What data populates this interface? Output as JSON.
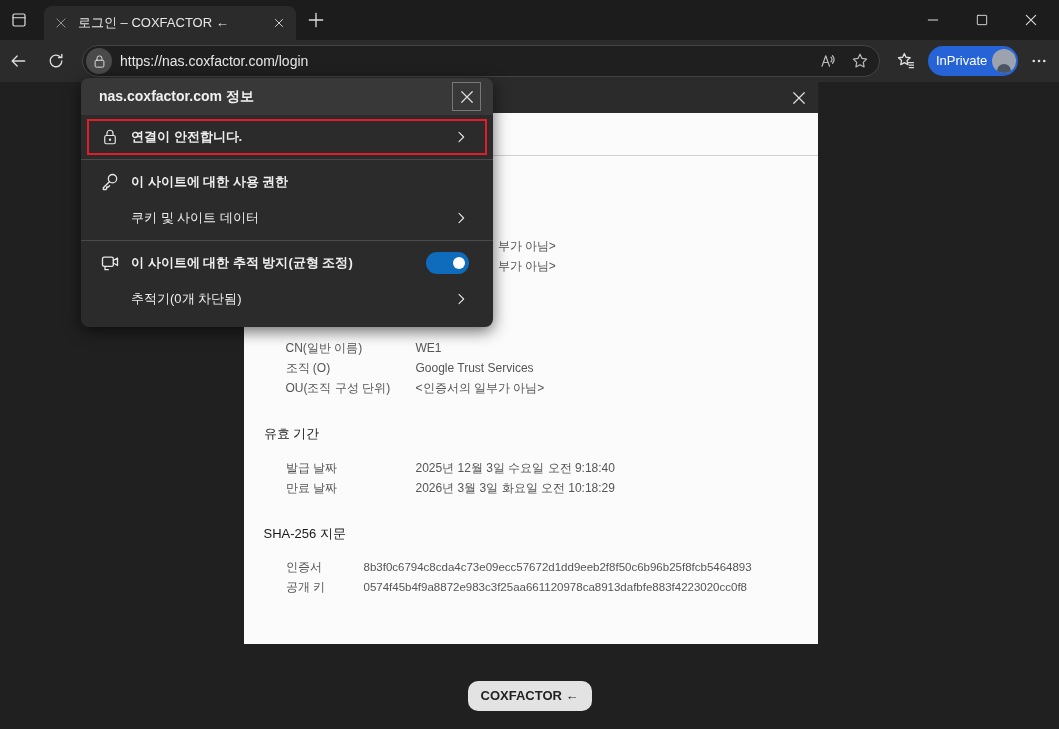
{
  "browser": {
    "tab_title": "로그인 – COXFACTOR ←",
    "address": "https://nas.coxfactor.com/login",
    "profile_label": "InPrivate"
  },
  "site_info_popup": {
    "title": "nas.coxfactor.com 정보",
    "groups": [
      {
        "items": [
          {
            "kind": "link",
            "label": "연결이 안전합니다.",
            "highlighted": true
          }
        ]
      },
      {
        "items": [
          {
            "kind": "header",
            "label": "이 사이트에 대한 사용 권한",
            "highlighted": false
          },
          {
            "kind": "link",
            "label": "쿠키 및 사이트 데이터",
            "highlighted": false
          }
        ]
      },
      {
        "items": [
          {
            "kind": "toggle",
            "label": "이 사이트에 대한 추적 방지(균형 조정)",
            "on": true,
            "highlighted": false
          },
          {
            "kind": "link",
            "label": "추적기(0개 차단됨)",
            "highlighted": false
          }
        ]
      }
    ]
  },
  "certificate_dialog": {
    "partial_values": [
      "부가 아님>",
      "부가 아님>"
    ],
    "sections": [
      {
        "kind": "names",
        "rows": [
          {
            "label": "CN(일반 이름)",
            "value": "WE1"
          },
          {
            "label": "조직 (O)",
            "value": "Google Trust Services"
          },
          {
            "label": "OU(조직 구성 단위)",
            "value": "<인증서의 일부가 아님>"
          }
        ]
      },
      {
        "kind": "names",
        "title": "유효 기간",
        "rows": [
          {
            "label": "발급 날짜",
            "value": "2025년 12월 3일 수요일 오전 9:18:40"
          },
          {
            "label": "만료 날짜",
            "value": "2026년 3월 3일 화요일 오전 10:18:29"
          }
        ]
      },
      {
        "kind": "fingerprint",
        "title": "SHA-256 지문",
        "rows": [
          {
            "label": "인증서",
            "value": "8b3f0c6794c8cda4c73e09ecc57672d1dd9eeb2f8f50c6b96b25f8fcb5464893"
          },
          {
            "label": "공개 키",
            "value": "0574f45b4f9a8872e983c3f25aa661120978ca8913dafbfe883f4223020cc0f8"
          }
        ]
      }
    ]
  },
  "page_button": "COXFACTOR ←"
}
